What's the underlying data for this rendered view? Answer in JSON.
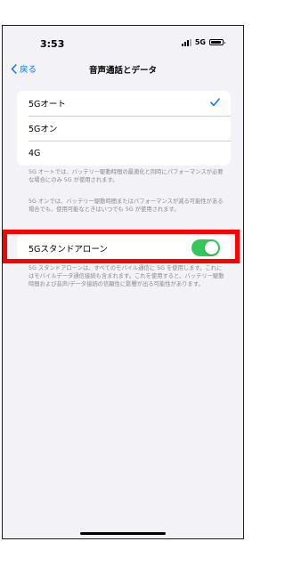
{
  "status_bar": {
    "time": "3:53",
    "network": "5G",
    "icons": [
      "signal-icon",
      "battery-icon"
    ]
  },
  "nav": {
    "back_label": "戻る",
    "title": "音声通話とデータ",
    "back_icon": "chevron-left-icon"
  },
  "mode_options": {
    "items": [
      {
        "label": "5Gオート",
        "selected": true
      },
      {
        "label": "5Gオン",
        "selected": false
      },
      {
        "label": "4G",
        "selected": false
      }
    ],
    "check_icon": "checkmark-icon"
  },
  "notes": {
    "auto": "5G オートでは、バッテリー駆動時間の最適化と同時にパフォーマンスが必要な場合にのみ 5G が使用されます。",
    "on": "5G オンでは、バッテリー駆動時間またはパフォーマンスが減る可能性がある場合でも、使用可能なときはいつでも 5G が使用されます。"
  },
  "standalone": {
    "label": "5Gスタンドアローン",
    "enabled": true,
    "footnote": "5G スタンドアローンは、すべてのモバイル通信に 5G を使用します。これにはモバイルデータ通信接続も含まれます。これを使用すると、バッテリー駆動時間および音声/データ接続の信頼性に影響が出る可能性があります。"
  },
  "colors": {
    "accent": "#0a7aff",
    "toggle_on": "#34c759",
    "highlight": "#ff0000",
    "background": "#f2f2f7"
  }
}
